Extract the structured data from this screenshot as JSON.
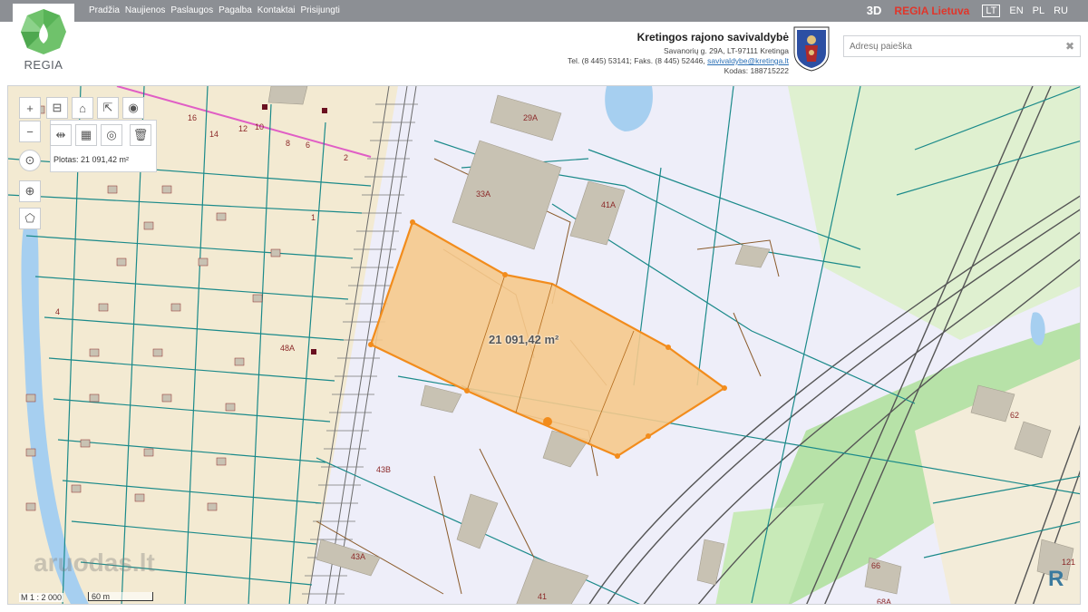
{
  "nav": {
    "items": [
      "Pradžia",
      "Naujienos",
      "Paslaugos",
      "Pagalba",
      "Kontaktai",
      "Prisijungti"
    ],
    "mode_3d": "3D",
    "regia_lt": "REGIA Lietuva",
    "languages": [
      "LT",
      "EN",
      "PL",
      "RU"
    ],
    "active_language": "LT"
  },
  "logo": {
    "text": "REGIA"
  },
  "municipality": {
    "title": "Kretingos rajono savivaldybė",
    "address": "Savanorių g. 29A, LT-97111 Kretinga",
    "phone_prefix": "Tel. (8 445) 53141; Faks. (8 445) 52446,",
    "email": "savivaldybe@kretinga.lt",
    "code": "Kodas: 188715222"
  },
  "search": {
    "placeholder": "Adresų paieška",
    "value": ""
  },
  "map": {
    "area_info": "Plotas: 21 091,42 m²",
    "area_map_label": "21 091,42 m²",
    "scale_text": "M 1 : 2 000",
    "scale_bar": "60 m",
    "watermark": "aruodas.lt",
    "parcel_labels": [
      "29A",
      "33A",
      "41A",
      "43B",
      "43A",
      "41",
      "62",
      "66",
      "68A",
      "121",
      "48A",
      "16",
      "14",
      "12",
      "10",
      "8",
      "6",
      "4",
      "2",
      "1"
    ],
    "colors": {
      "parcel_fill": "#f5c98c",
      "parcel_stroke": "#f28c1c",
      "cadastre_line": "#1b8a8a",
      "water": "#a6cff0",
      "green": "#b7e2a8",
      "building": "#c8c2b3"
    }
  },
  "tools": {
    "zoom_in": "+",
    "zoom_out": "−"
  }
}
